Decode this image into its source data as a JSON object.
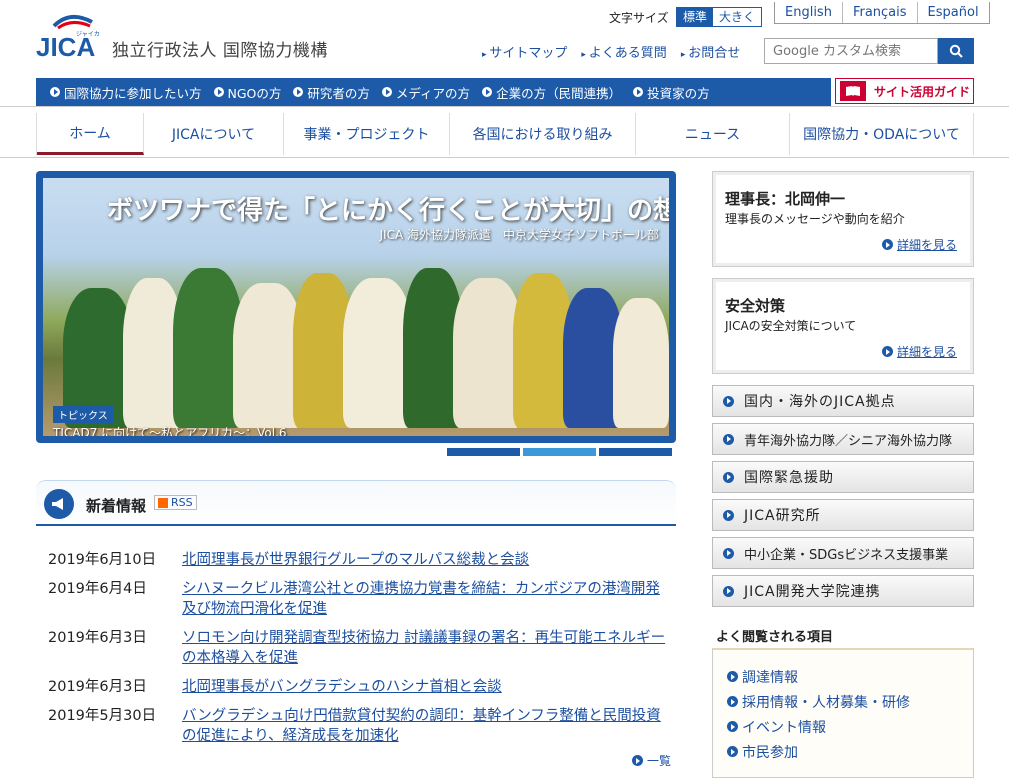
{
  "header": {
    "org_name": "独立行政法人 国際協力機構",
    "logo_text": "JICA",
    "logo_kana": "ジャイカ",
    "font_size_label": "文字サイズ",
    "font_size_options": [
      "標準",
      "大きく"
    ],
    "languages": [
      "English",
      "Français",
      "Español"
    ],
    "util_links": [
      "サイトマップ",
      "よくある質問",
      "お問合せ"
    ],
    "search_placeholder": "Google カスタム検索"
  },
  "audience_bar": {
    "items": [
      "国際協力に参加したい方",
      "NGOの方",
      "研究者の方",
      "メディアの方",
      "企業の方（民間連携）",
      "投資家の方"
    ],
    "guide_label": "サイト活用ガイド"
  },
  "global_nav": {
    "items": [
      "ホーム",
      "JICAについて",
      "事業・プロジェクト",
      "各国における取り組み",
      "ニュース",
      "国際協力・ODAについて"
    ]
  },
  "hero": {
    "title": "ボツワナで得た「とにかく行くことが大切」の想い",
    "subtitle": "JICA 海外協力隊派遣　中京大学女子ソフトボール部",
    "tag": "トピックス",
    "caption": "TICAD7 に向けて〜私とアフリカ〜：Vol.6"
  },
  "news": {
    "title": "新着情報",
    "rss": "RSS",
    "items": [
      {
        "date": "2019年6月10日",
        "text": "北岡理事長が世界銀行グループのマルパス総裁と会談"
      },
      {
        "date": "2019年6月4日",
        "text": "シハヌークビル港湾公社との連携協力覚書を締結：カンボジアの港湾開発及び物流円滑化を促進"
      },
      {
        "date": "2019年6月3日",
        "text": "ソロモン向け開発調査型技術協力 討議議事録の署名：再生可能エネルギーの本格導入を促進"
      },
      {
        "date": "2019年6月3日",
        "text": "北岡理事長がバングラデシュのハシナ首相と会談"
      },
      {
        "date": "2019年5月30日",
        "text": "バングラデシュ向け円借款貸付契約の調印：基幹インフラ整備と民間投資の促進により、経済成長を加速化"
      }
    ],
    "more": "一覧"
  },
  "sidebar": {
    "cards": [
      {
        "title": "理事長：北岡伸一",
        "desc": "理事長のメッセージや動向を紹介",
        "more": "詳細を見る"
      },
      {
        "title": "安全対策",
        "desc": "JICAの安全対策について",
        "more": "詳細を見る"
      }
    ],
    "links": [
      "国内・海外のJICA拠点",
      "青年海外協力隊／シニア海外協力隊",
      "国際緊急援助",
      "JICA研究所",
      "中小企業・SDGsビジネス支援事業",
      "JICA開発大学院連携"
    ],
    "freq_title": "よく閲覧される項目",
    "freq_items": [
      "調達情報",
      "採用情報・人材募集・研修",
      "イベント情報",
      "市民参加"
    ]
  },
  "colors": {
    "brand_blue": "#1d5aa8",
    "accent_red": "#cc0033",
    "nav_underline": "#8b1a2b"
  }
}
